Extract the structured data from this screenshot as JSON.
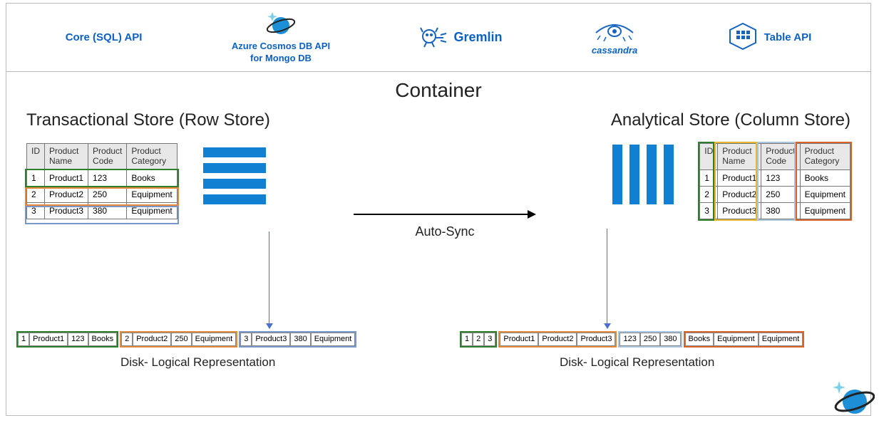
{
  "apis": {
    "core": "Core (SQL) API",
    "cosmos_line1": "Azure Cosmos DB API",
    "cosmos_line2": "for Mongo DB",
    "gremlin": "Gremlin",
    "cassandra": "cassandra",
    "table": "Table API"
  },
  "container_title": "Container",
  "left_store_title": "Transactional Store (Row Store)",
  "right_store_title": "Analytical Store (Column Store)",
  "auto_sync_label": "Auto-Sync",
  "disk_label": "Disk- Logical Representation",
  "columns": {
    "id": "ID",
    "name": "Product\nName",
    "code": "Product\nCode",
    "cat": "Product\nCategory"
  },
  "rows": [
    {
      "id": "1",
      "name": "Product1",
      "code": "123",
      "cat": "Books"
    },
    {
      "id": "2",
      "name": "Product2",
      "code": "250",
      "cat": "Equipment"
    },
    {
      "id": "3",
      "name": "Product3",
      "code": "380",
      "cat": "Equipment"
    }
  ],
  "colors": {
    "row1": "#2f7d2f",
    "row2": "#e58a3a",
    "row3": "#7a97c9",
    "col1": "#2f7d2f",
    "col2": "#e7b92a",
    "col3": "#a9c4dd",
    "col4": "#d8642a"
  },
  "chart_data": {
    "type": "table",
    "title": "Row vs Column store layout of the same product data",
    "columns": [
      "ID",
      "Product Name",
      "Product Code",
      "Product Category"
    ],
    "records": [
      [
        "1",
        "Product1",
        "123",
        "Books"
      ],
      [
        "2",
        "Product2",
        "250",
        "Equipment"
      ],
      [
        "3",
        "Product3",
        "380",
        "Equipment"
      ]
    ],
    "row_store_disk_order": [
      "1",
      "Product1",
      "123",
      "Books",
      "2",
      "Product2",
      "250",
      "Equipment",
      "3",
      "Product3",
      "380",
      "Equipment"
    ],
    "column_store_disk_order": [
      [
        "1",
        "2",
        "3"
      ],
      [
        "Product1",
        "Product2",
        "Product3"
      ],
      [
        "123",
        "250",
        "380"
      ],
      [
        "Books",
        "Equipment",
        "Equipment"
      ]
    ]
  }
}
